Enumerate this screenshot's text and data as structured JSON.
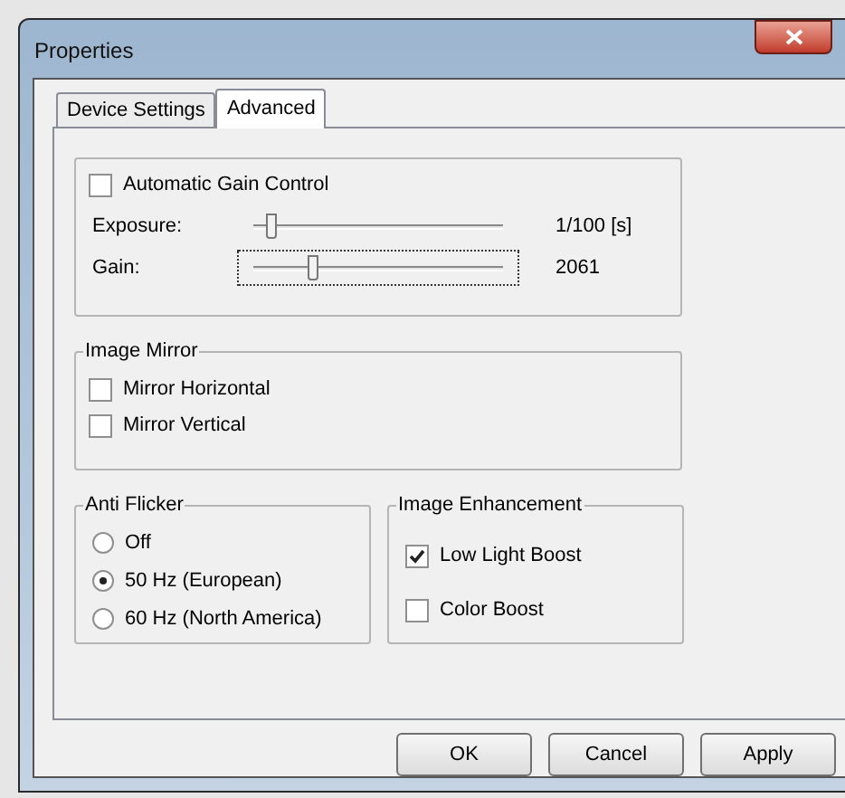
{
  "window": {
    "title": "Properties"
  },
  "tabs": [
    {
      "label": "Device Settings",
      "selected": false
    },
    {
      "label": "Advanced",
      "selected": true
    }
  ],
  "gain_control": {
    "automatic": {
      "label": "Automatic Gain Control",
      "checked": false
    },
    "sliders": [
      {
        "label": "Exposure:",
        "level": 0.07,
        "reading": "1/100 [s]",
        "focused": false
      },
      {
        "label": "Gain:",
        "level": 0.24,
        "reading": "2061",
        "focused": true
      }
    ]
  },
  "image_mirror": {
    "title": "Image Mirror",
    "options": [
      {
        "label": "Mirror Horizontal",
        "checked": false
      },
      {
        "label": "Mirror Vertical",
        "checked": false
      }
    ]
  },
  "anti_flicker": {
    "title": "Anti Flicker",
    "options": [
      {
        "label": "Off",
        "selected": false
      },
      {
        "label": "50 Hz (European)",
        "selected": true
      },
      {
        "label": "60 Hz (North America)",
        "selected": false
      }
    ]
  },
  "image_enhancement": {
    "title": "Image Enhancement",
    "options": [
      {
        "label": "Low Light Boost",
        "checked": true
      },
      {
        "label": "Color Boost",
        "checked": false
      }
    ]
  },
  "buttons": [
    "OK",
    "Cancel",
    "Apply"
  ]
}
